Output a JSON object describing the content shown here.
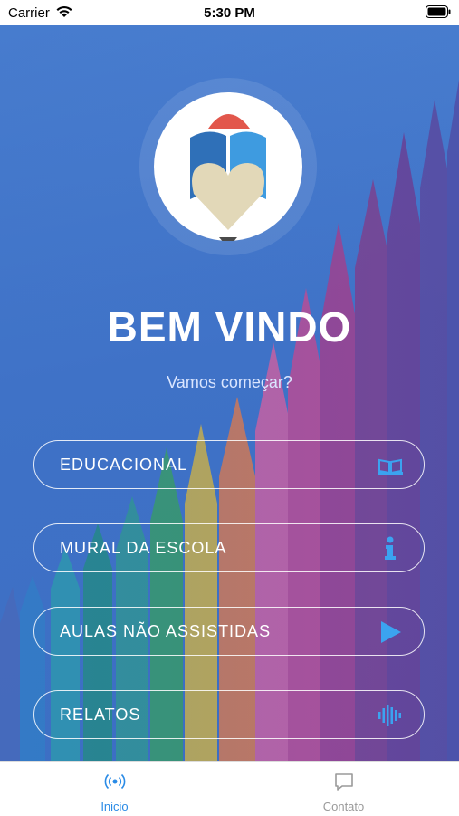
{
  "status_bar": {
    "carrier": "Carrier",
    "time": "5:30 PM"
  },
  "main": {
    "title": "BEM VINDO",
    "subtitle": "Vamos começar?",
    "menu": [
      {
        "label": "EDUCACIONAL",
        "icon": "open-book-icon"
      },
      {
        "label": "MURAL DA ESCOLA",
        "icon": "info-icon"
      },
      {
        "label": "AULAS NÃO ASSISTIDAS",
        "icon": "play-icon"
      },
      {
        "label": "RELATOS",
        "icon": "audio-wave-icon"
      }
    ]
  },
  "tab_bar": {
    "tabs": [
      {
        "label": "Inicio",
        "icon": "broadcast-icon",
        "active": true
      },
      {
        "label": "Contato",
        "icon": "chat-bubble-icon",
        "active": false
      }
    ]
  },
  "colors": {
    "accent": "#2a8be6",
    "background": "#3f72c7",
    "icon_blue": "#3ba3f0"
  }
}
